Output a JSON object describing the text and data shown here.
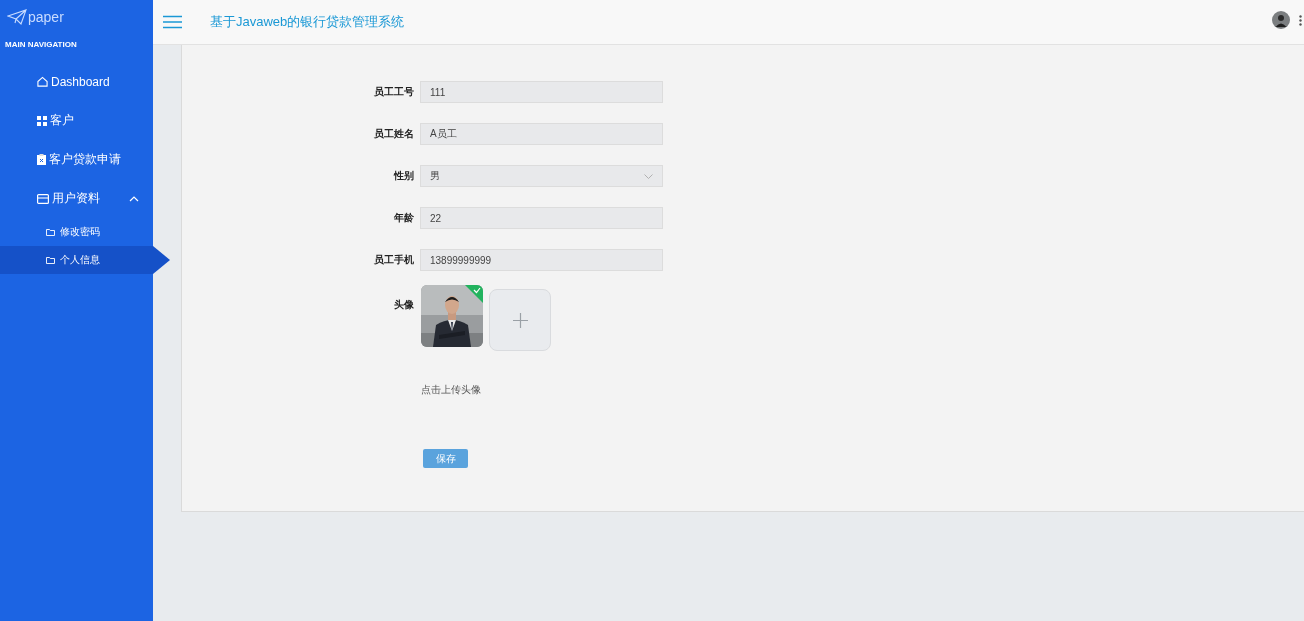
{
  "brand": {
    "name": "paper"
  },
  "header": {
    "title": "基于Javaweb的银行贷款管理系统"
  },
  "sidebar": {
    "heading": "MAIN NAVIGATION",
    "items": [
      {
        "label": "Dashboard",
        "selected": false
      },
      {
        "label": "客户",
        "selected": false
      },
      {
        "label": "客户贷款申请",
        "selected": false
      },
      {
        "label": "用户资料",
        "selected": false,
        "expanded": true,
        "children": [
          {
            "label": "修改密码",
            "selected": false
          },
          {
            "label": "个人信息",
            "selected": true
          }
        ]
      }
    ]
  },
  "form": {
    "fields": [
      {
        "label": "员工工号",
        "kind": "text",
        "value": "111"
      },
      {
        "label": "员工姓名",
        "kind": "text",
        "value": "A员工"
      },
      {
        "label": "性别",
        "kind": "select",
        "value": "男"
      },
      {
        "label": "年龄",
        "kind": "text",
        "value": "22"
      },
      {
        "label": "员工手机",
        "kind": "text",
        "value": "13899999999"
      }
    ],
    "avatar": {
      "label": "头像",
      "uploaded": true
    },
    "hint": "点击上传头像",
    "save_button": "保存"
  }
}
